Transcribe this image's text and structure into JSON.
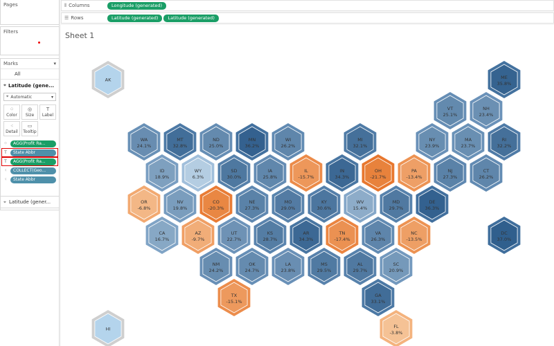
{
  "left_panel": {
    "pages_title": "Pages",
    "filters_title": "Filters",
    "marks_title": "Marks",
    "marks_all": "All",
    "marks_sub": "Latitude (gene...",
    "mark_type": "Automatic",
    "shelf_buttons": [
      {
        "label": "Color",
        "icon": "color-icon"
      },
      {
        "label": "Size",
        "icon": "size-icon"
      },
      {
        "label": "Label",
        "icon": "label-icon"
      },
      {
        "label": "Detail",
        "icon": "detail-icon"
      },
      {
        "label": "Tooltip",
        "icon": "tooltip-icon"
      }
    ],
    "pills": [
      {
        "label": "AGG(Profit Ra...",
        "color": "green",
        "icon": "color-icon",
        "selected": false
      },
      {
        "label": "State Abbr",
        "color": "blue",
        "icon": "label-icon",
        "selected": true
      },
      {
        "label": "AGG(Profit Ra...",
        "color": "green",
        "icon": "label-icon",
        "selected": true
      },
      {
        "label": "COLLECT(Geo...",
        "color": "blue",
        "icon": "detail-icon",
        "selected": false
      },
      {
        "label": "State Abbr",
        "color": "blue",
        "icon": "detail-icon",
        "selected": false
      }
    ],
    "latitude_card": "Latitude (gener..."
  },
  "shelves": {
    "columns_label": "Columns",
    "rows_label": "Rows",
    "columns": [
      "Longitude (generated)"
    ],
    "rows": [
      "Latitude (generated)",
      "Latitude (generated)"
    ]
  },
  "sheet": {
    "title": "Sheet 1"
  },
  "colors": {
    "neg_strong": "#e8813b",
    "neg_light": "#f4b37a",
    "pos_light": "#b4d4ec",
    "pos_mid": "#7ea9cf",
    "pos_dark": "#2c5b8a",
    "gray": "#cfcfcf"
  },
  "states": [
    {
      "abbr": "AK",
      "value": "",
      "row": 0,
      "col": 0,
      "num": null
    },
    {
      "abbr": "ME",
      "value": "35.8%",
      "row": 0,
      "col": 11,
      "num": 35.8
    },
    {
      "abbr": "VT",
      "value": "25.1%",
      "row": 1,
      "col": 9.5,
      "num": 25.1
    },
    {
      "abbr": "NH",
      "value": "23.4%",
      "row": 1,
      "col": 10.5,
      "num": 23.4
    },
    {
      "abbr": "WA",
      "value": "24.1%",
      "row": 2,
      "col": 1,
      "num": 24.1
    },
    {
      "abbr": "MT",
      "value": "32.8%",
      "row": 2,
      "col": 2,
      "num": 32.8
    },
    {
      "abbr": "ND",
      "value": "25.0%",
      "row": 2,
      "col": 3,
      "num": 25.0
    },
    {
      "abbr": "MN",
      "value": "36.2%",
      "row": 2,
      "col": 4,
      "num": 36.2
    },
    {
      "abbr": "WI",
      "value": "26.2%",
      "row": 2,
      "col": 5,
      "num": 26.2
    },
    {
      "abbr": "MI",
      "value": "32.1%",
      "row": 2,
      "col": 7,
      "num": 32.1
    },
    {
      "abbr": "NY",
      "value": "23.9%",
      "row": 2,
      "col": 9,
      "num": 23.9
    },
    {
      "abbr": "MA",
      "value": "23.7%",
      "row": 2,
      "col": 10,
      "num": 23.7
    },
    {
      "abbr": "RI",
      "value": "32.2%",
      "row": 2,
      "col": 11,
      "num": 32.2
    },
    {
      "abbr": "ID",
      "value": "18.9%",
      "row": 3,
      "col": 1.5,
      "num": 18.9
    },
    {
      "abbr": "WY",
      "value": "6.3%",
      "row": 3,
      "col": 2.5,
      "num": 6.3
    },
    {
      "abbr": "SD",
      "value": "30.0%",
      "row": 3,
      "col": 3.5,
      "num": 30.0
    },
    {
      "abbr": "IA",
      "value": "25.8%",
      "row": 3,
      "col": 4.5,
      "num": 25.8
    },
    {
      "abbr": "IL",
      "value": "-15.7%",
      "row": 3,
      "col": 5.5,
      "num": -15.7
    },
    {
      "abbr": "IN",
      "value": "34.3%",
      "row": 3,
      "col": 6.5,
      "num": 34.3
    },
    {
      "abbr": "OH",
      "value": "-21.7%",
      "row": 3,
      "col": 7.5,
      "num": -21.7
    },
    {
      "abbr": "PA",
      "value": "-13.4%",
      "row": 3,
      "col": 8.5,
      "num": -13.4
    },
    {
      "abbr": "NJ",
      "value": "27.3%",
      "row": 3,
      "col": 9.5,
      "num": 27.3
    },
    {
      "abbr": "CT",
      "value": "26.2%",
      "row": 3,
      "col": 10.5,
      "num": 26.2
    },
    {
      "abbr": "OR",
      "value": "-6.8%",
      "row": 4,
      "col": 1,
      "num": -6.8
    },
    {
      "abbr": "NV",
      "value": "19.8%",
      "row": 4,
      "col": 2,
      "num": 19.8
    },
    {
      "abbr": "CO",
      "value": "-20.3%",
      "row": 4,
      "col": 3,
      "num": -20.3
    },
    {
      "abbr": "NE",
      "value": "27.3%",
      "row": 4,
      "col": 4,
      "num": 27.3
    },
    {
      "abbr": "MO",
      "value": "29.0%",
      "row": 4,
      "col": 5,
      "num": 29.0
    },
    {
      "abbr": "KY",
      "value": "30.6%",
      "row": 4,
      "col": 6,
      "num": 30.6
    },
    {
      "abbr": "WV",
      "value": "15.4%",
      "row": 4,
      "col": 7,
      "num": 15.4
    },
    {
      "abbr": "MD",
      "value": "29.7%",
      "row": 4,
      "col": 8,
      "num": 29.7
    },
    {
      "abbr": "DE",
      "value": "36.3%",
      "row": 4,
      "col": 9,
      "num": 36.3
    },
    {
      "abbr": "CA",
      "value": "16.7%",
      "row": 5,
      "col": 1.5,
      "num": 16.7
    },
    {
      "abbr": "AZ",
      "value": "-9.7%",
      "row": 5,
      "col": 2.5,
      "num": -9.7
    },
    {
      "abbr": "UT",
      "value": "22.7%",
      "row": 5,
      "col": 3.5,
      "num": 22.7
    },
    {
      "abbr": "KS",
      "value": "28.7%",
      "row": 5,
      "col": 4.5,
      "num": 28.7
    },
    {
      "abbr": "AR",
      "value": "34.3%",
      "row": 5,
      "col": 5.5,
      "num": 34.3
    },
    {
      "abbr": "TN",
      "value": "-17.4%",
      "row": 5,
      "col": 6.5,
      "num": -17.4
    },
    {
      "abbr": "VA",
      "value": "26.3%",
      "row": 5,
      "col": 7.5,
      "num": 26.3
    },
    {
      "abbr": "NC",
      "value": "-13.5%",
      "row": 5,
      "col": 8.5,
      "num": -13.5
    },
    {
      "abbr": "DC",
      "value": "37.0%",
      "row": 5,
      "col": 11,
      "num": 37.0
    },
    {
      "abbr": "NM",
      "value": "24.2%",
      "row": 6,
      "col": 3,
      "num": 24.2
    },
    {
      "abbr": "OK",
      "value": "24.7%",
      "row": 6,
      "col": 4,
      "num": 24.7
    },
    {
      "abbr": "LA",
      "value": "23.8%",
      "row": 6,
      "col": 5,
      "num": 23.8
    },
    {
      "abbr": "MS",
      "value": "29.5%",
      "row": 6,
      "col": 6,
      "num": 29.5
    },
    {
      "abbr": "AL",
      "value": "29.7%",
      "row": 6,
      "col": 7,
      "num": 29.7
    },
    {
      "abbr": "SC",
      "value": "20.9%",
      "row": 6,
      "col": 8,
      "num": 20.9
    },
    {
      "abbr": "TX",
      "value": "-15.1%",
      "row": 7,
      "col": 3.5,
      "num": -15.1
    },
    {
      "abbr": "GA",
      "value": "33.1%",
      "row": 7,
      "col": 7.5,
      "num": 33.1
    },
    {
      "abbr": "HI",
      "value": "",
      "row": 8,
      "col": 0,
      "num": null
    },
    {
      "abbr": "FL",
      "value": "-3.8%",
      "row": 8,
      "col": 8,
      "num": -3.8
    }
  ]
}
